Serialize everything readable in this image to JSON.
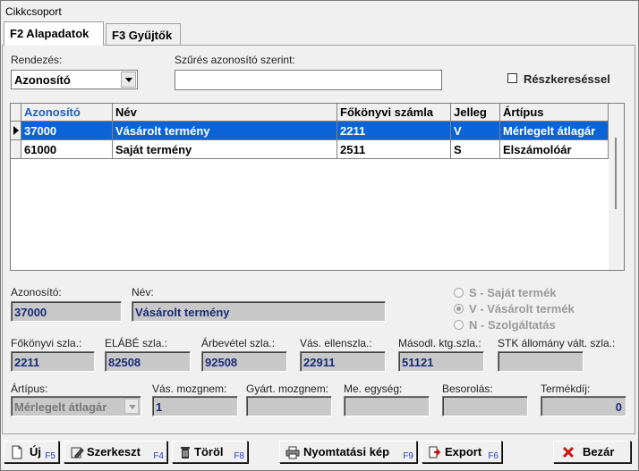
{
  "window": {
    "title": "Cikkcsoport"
  },
  "tabs": [
    {
      "label": "F2 Alapadatok",
      "active": true
    },
    {
      "label": "F3 Gyűjtők",
      "active": false
    }
  ],
  "filters": {
    "sort_label": "Rendezés:",
    "sort_value": "Azonosító",
    "search_label": "Szűrés azonosító szerint:",
    "search_value": "",
    "partial_label": "Részkereséssel",
    "partial_checked": false
  },
  "grid": {
    "columns": [
      "Azonosító",
      "Név",
      "Főkönyvi számla",
      "Jelleg",
      "Ártípus"
    ],
    "sorted_column": "Azonosító",
    "rows": [
      {
        "azonosito": "37000",
        "nev": "Vásárolt termény",
        "fokonyvi": "2211",
        "jelleg": "V",
        "artipus": "Mérlegelt átlagár",
        "selected": true
      },
      {
        "azonosito": "61000",
        "nev": "Saját termény",
        "fokonyvi": "2511",
        "jelleg": "S",
        "artipus": "Elszámolóár",
        "selected": false
      }
    ]
  },
  "detail": {
    "azonosito_label": "Azonosító:",
    "azonosito": "37000",
    "nev_label": "Név:",
    "nev": "Vásárolt termény",
    "jelleg_options": [
      {
        "label": "S - Saját termék",
        "selected": false
      },
      {
        "label": "V - Vásárolt termék",
        "selected": true
      },
      {
        "label": "N - Szolgáltatás",
        "selected": false
      }
    ],
    "fokonyvi_label": "Főkönyvi szla.:",
    "fokonyvi": "2211",
    "elabe_label": "ELÁBÉ szla.:",
    "elabe": "82508",
    "arbevetel_label": "Árbevétel szla.:",
    "arbevetel": "92508",
    "vas_ellen_label": "Vás. ellenszla.:",
    "vas_ellen": "22911",
    "masodl_label": "Másodl. ktg.szla.:",
    "masodl": "51121",
    "stk_label": "STK állomány vált. szla.:",
    "stk": "",
    "artipus_label": "Ártípus:",
    "artipus": "Mérlegelt átlagár",
    "vas_mozg_label": "Vás. mozgnem:",
    "vas_mozg": "1",
    "gyart_mozg_label": "Gyárt. mozgnem:",
    "gyart_mozg": "",
    "me_label": "Me. egység:",
    "me": "",
    "besorolas_label": "Besorolás:",
    "besorolas": "",
    "termekdij_label": "Termékdíj:",
    "termekdij": "0"
  },
  "buttons": {
    "new": {
      "label": "Új",
      "key": "F5"
    },
    "edit": {
      "label": "Szerkeszt",
      "key": "F4"
    },
    "delete": {
      "label": "Töröl",
      "key": "F8"
    },
    "print": {
      "label": "Nyomtatási kép",
      "key": "F9"
    },
    "export": {
      "label": "Export",
      "key": "F6"
    },
    "close": {
      "label": "Bezár"
    }
  },
  "colors": {
    "selection": "#0a64d8",
    "sorted_header": "#1e5fc8",
    "readonly_bg": "#c8c8c8",
    "readonly_text": "#1a2a7a"
  }
}
